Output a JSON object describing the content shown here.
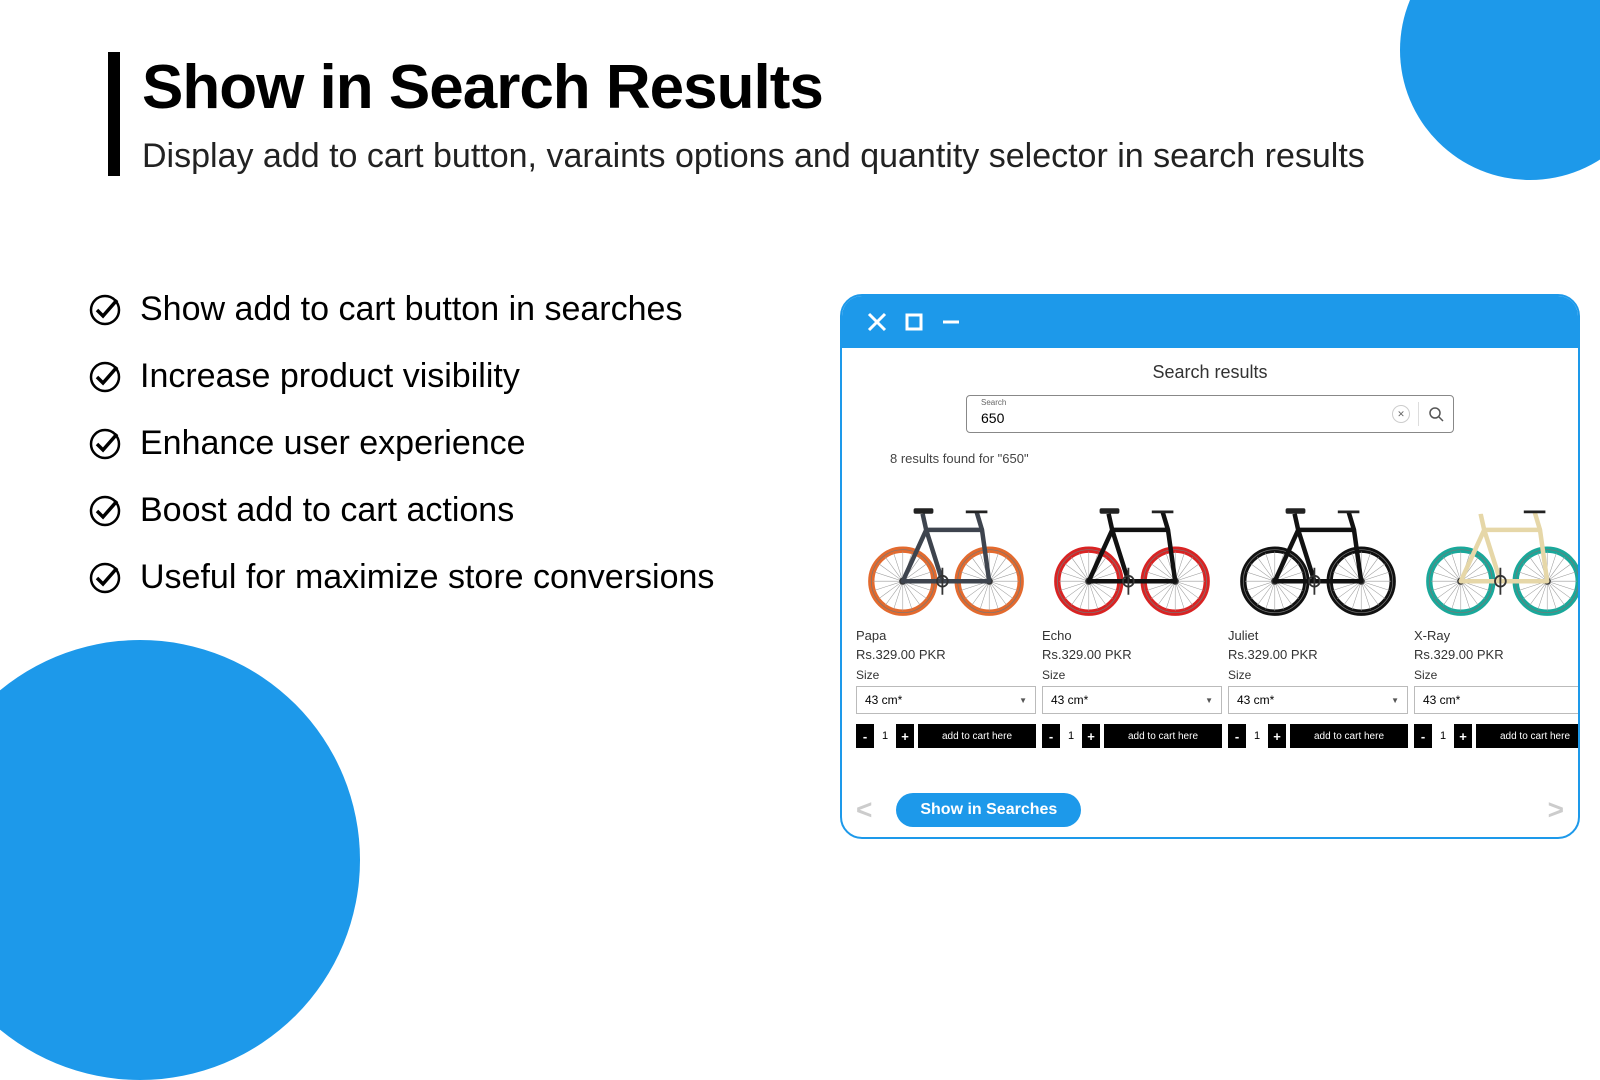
{
  "header": {
    "title": "Show in Search Results",
    "subtitle": "Display add to cart button, varaints options and quantity selector in search results"
  },
  "features": [
    "Show add to cart button in searches",
    "Increase product visibility",
    "Enhance user experience",
    "Boost add to cart actions",
    "Useful for maximize store conversions"
  ],
  "window": {
    "search_title": "Search results",
    "search_label": "Search",
    "search_value": "650",
    "results_count": "8 results found for \"650\"",
    "show_in_searches": "Show in Searches",
    "add_to_cart_label": "add to cart here",
    "size_label": "Size",
    "default_size": "43 cm*",
    "qty": "1"
  },
  "products": [
    {
      "name": "Papa",
      "price": "Rs.329.00 PKR",
      "frame": "#3e444e",
      "wheel": "#e36a2e"
    },
    {
      "name": "Echo",
      "price": "Rs.329.00 PKR",
      "frame": "#111111",
      "wheel": "#d92323"
    },
    {
      "name": "Juliet",
      "price": "Rs.329.00 PKR",
      "frame": "#111111",
      "wheel": "#111111"
    },
    {
      "name": "X-Ray",
      "price": "Rs.329.00 PKR",
      "frame": "#e6d7a8",
      "wheel": "#1aa89a"
    }
  ]
}
